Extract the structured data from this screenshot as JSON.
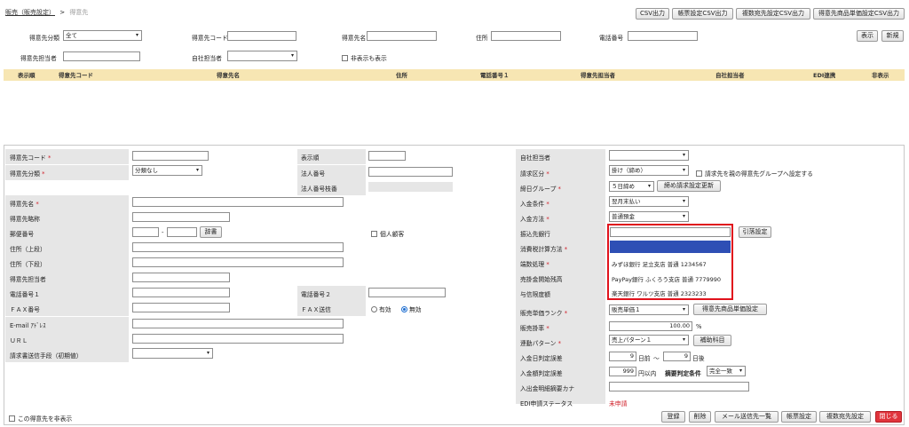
{
  "breadcrumb": {
    "parent": "販売（販売設定）",
    "sep": ">",
    "current": "得意先"
  },
  "top_buttons": [
    "CSV出力",
    "帳票設定CSV出力",
    "複数宛先設定CSV出力",
    "得意先商品単価設定CSV出力"
  ],
  "search": {
    "category_label": "得意先分類",
    "category_value": "全て",
    "code_label": "得意先コード",
    "name_label": "得意先名",
    "address_label": "住所",
    "phone_label": "電話番号",
    "rep_label": "得意先担当者",
    "own_rep_label": "自社担当者",
    "show_hidden_label": "非表示も表示",
    "show_button": "表示",
    "new_button": "新規"
  },
  "table_headers": [
    "表示順",
    "得意先コード",
    "得意先名",
    "住所",
    "電話番号１",
    "得意先担当者",
    "自社担当者",
    "EDI連携",
    "非表示"
  ],
  "form": {
    "code_label": "得意先コード",
    "category_label": "得意先分類",
    "category_value": "分類なし",
    "display_order_label": "表示順",
    "corp_no_label": "法人番号",
    "corp_branch_label": "法人番号枝番",
    "name_label": "得意先名",
    "short_name_label": "得意先略称",
    "zip_label": "郵便番号",
    "zip_sep": "-",
    "dict_button": "辞書",
    "individual_label": "個人顧客",
    "addr1_label": "住所（上段）",
    "addr2_label": "住所（下段）",
    "rep_label": "得意先担当者",
    "phone1_label": "電話番号１",
    "phone2_label": "電話番号２",
    "fax_label": "ＦＡＸ番号",
    "fax_send_label": "ＦＡＸ送信",
    "fax_on": "有効",
    "fax_off": "無効",
    "email_label": "E-mail ｱﾄﾞﾚｽ",
    "url_label": "ＵＲＬ",
    "invoice_method_label": "請求書送信手段（初期値）",
    "hide_label": "この得意先を非表示",
    "own_rep_label": "自社担当者",
    "billing_label": "請求区分",
    "billing_value": "掛け（締め）",
    "billing_group_label": "請求先を親の得意先グループへ設定する",
    "closing_group_label": "締日グループ",
    "closing_group_value": "５日締め",
    "closing_update_button": "締め請求設定更新",
    "payment_cond_label": "入金条件",
    "payment_cond_value": "翌月末払い",
    "payment_method_label": "入金方法",
    "payment_method_value": "普通預金",
    "bank_label": "振込先銀行",
    "bank_setting_button": "引落設定",
    "tax_method_label": "消費税計算方法",
    "rounding_label": "端数処理",
    "ar_balance_label": "売掛金開始残高",
    "credit_label": "与信限度額",
    "price_rank_label": "販売単価ランク",
    "price_rank_value": "販売単価１",
    "price_button": "得意先商品単価設定",
    "sales_rate_label": "販売掛率",
    "sales_rate_value": "100.00",
    "sales_rate_unit": "%",
    "link_pattern_label": "連動パターン",
    "link_pattern_value": "売上パターン１",
    "aux_button": "補助科目",
    "date_tol_label": "入金日判定誤差",
    "date_before": "9",
    "date_before_unit": "日前",
    "date_tilde": "～",
    "date_after": "9",
    "date_after_unit": "日後",
    "amount_tol_label": "入金額判定誤差",
    "amount_value": "999",
    "amount_unit": "円以内",
    "summary_cond_label": "摘要判定条件",
    "summary_cond_value": "完全一致",
    "kana_label": "入出金明細摘要カナ",
    "edi_label": "EDI申請ステータス",
    "edi_value": "未申請"
  },
  "bank_dropdown": {
    "options": [
      "",
      "みずほ銀行 足立支店 普通 1234567",
      "PayPay銀行 ふくろう支店 普通 7779990",
      "楽天銀行 ワルツ支店 普通 2323233"
    ]
  },
  "bottom_buttons": [
    "登録",
    "削除",
    "メール送信先一覧",
    "帳票設定",
    "複数宛先設定",
    "閉じる"
  ],
  "colors": {
    "header_bar": "#f7e6b3",
    "label_bg": "#e6e6e6",
    "highlight": "#e0121c",
    "selected_option": "#2e4fb5",
    "close_button": "#e0343c"
  }
}
